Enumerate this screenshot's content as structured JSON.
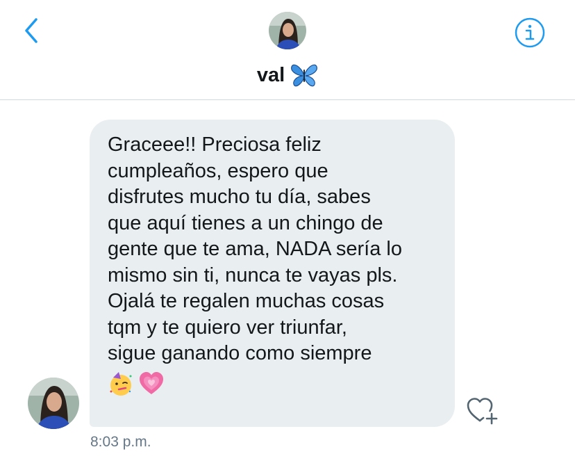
{
  "header": {
    "title": "val",
    "title_emoji": "butterfly-emoji",
    "back_icon": "chevron-left-icon",
    "info_icon": "info-icon",
    "accent_color": "#1d9bf0"
  },
  "message": {
    "text": "Graceee!! Preciosa feliz\ncumpleaños, espero que\ndisfrutes mucho tu día, sabes\nque aquí tienes a un chingo de\ngente que te ama, NADA sería lo\nmismo sin ti, nunca te vayas pls.\nOjalá te regalen muchas cosas\ntqm y te quiero ver triunfar,\nsigue ganando como siempre",
    "emojis": [
      "partying-face-emoji",
      "growing-heart-emoji"
    ],
    "timestamp": "8:03 p.m.",
    "bubble_color": "#e9eef1"
  }
}
